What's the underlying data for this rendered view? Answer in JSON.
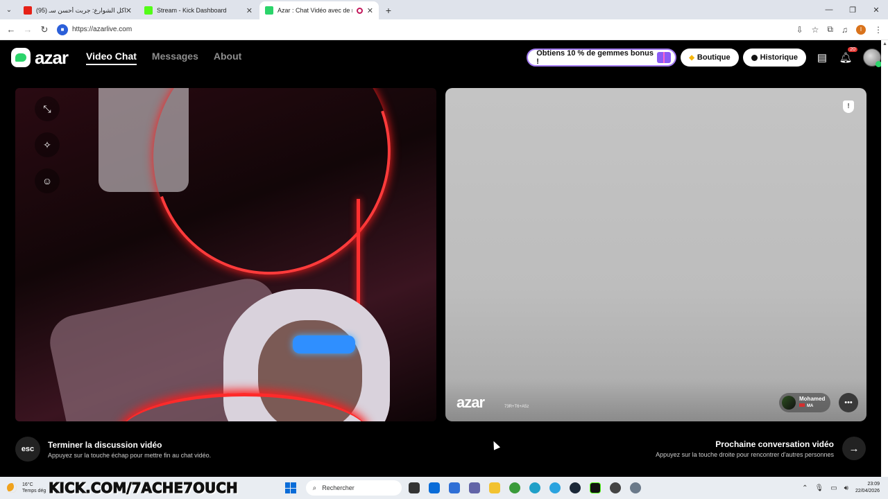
{
  "browser": {
    "tabs": [
      {
        "title": "(95) اكل الشوارع: جربت أحسن سـ...",
        "favicon_color": "#e62117",
        "active": false
      },
      {
        "title": "Stream - Kick Dashboard",
        "favicon_color": "#53fc18",
        "active": false
      },
      {
        "title": "Azar : Chat Vidéo avec de n",
        "favicon_color": "#2bd46a",
        "active": true
      }
    ],
    "url": "https://azarlive.com",
    "profile_initial": "I"
  },
  "app": {
    "logo": "azar",
    "nav": [
      {
        "label": "Video Chat",
        "active": true
      },
      {
        "label": "Messages",
        "active": false
      },
      {
        "label": "About",
        "active": false
      }
    ],
    "promo_label": "Obtiens 10 % de gemmes bonus !",
    "shop_label": "Boutique",
    "history_label": "Historique",
    "notification_count": "20",
    "accent_color": "#2bd46a"
  },
  "remote_video": {
    "watermark_logo": "azar",
    "watermark_id": "73R+T6+A5z",
    "peer_name": "Mohamed",
    "peer_country": "MA"
  },
  "controls": {
    "end": {
      "key_label": "esc",
      "title": "Terminer la discussion vidéo",
      "subtitle": "Appuyez sur la touche échap pour mettre fin au chat vidéo."
    },
    "next": {
      "title": "Prochaine conversation vidéo",
      "subtitle": "Appuyez sur la touche droite pour rencontrer d'autres personnes"
    }
  },
  "taskbar": {
    "temperature": "16°C",
    "weather_text": "Temps dég",
    "overlay_text": "KICK.COM/7ACHE7OUCH",
    "search_placeholder": "Rechercher",
    "time": "23:09",
    "date": "22/04/2026"
  }
}
